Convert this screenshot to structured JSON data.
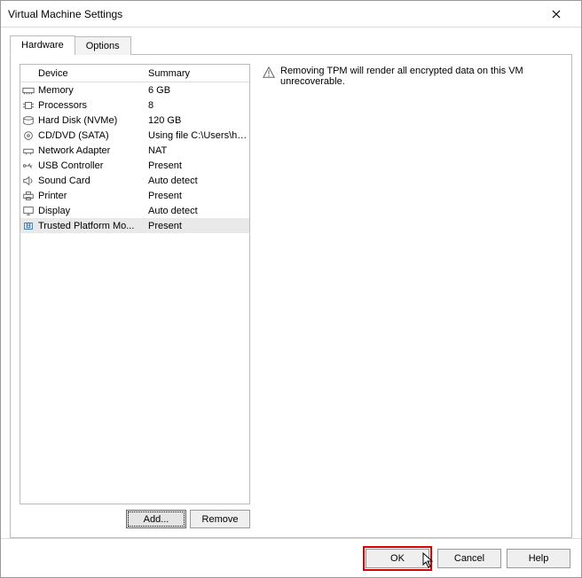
{
  "window": {
    "title": "Virtual Machine Settings"
  },
  "tabs": {
    "hardware": "Hardware",
    "options": "Options"
  },
  "headers": {
    "device": "Device",
    "summary": "Summary"
  },
  "devices": [
    {
      "icon": "memory",
      "name": "Memory",
      "summary": "6 GB"
    },
    {
      "icon": "cpu",
      "name": "Processors",
      "summary": "8"
    },
    {
      "icon": "disk",
      "name": "Hard Disk (NVMe)",
      "summary": "120 GB"
    },
    {
      "icon": "cd",
      "name": "CD/DVD (SATA)",
      "summary": "Using file C:\\Users\\hung\\Do..."
    },
    {
      "icon": "network",
      "name": "Network Adapter",
      "summary": "NAT"
    },
    {
      "icon": "usb",
      "name": "USB Controller",
      "summary": "Present"
    },
    {
      "icon": "sound",
      "name": "Sound Card",
      "summary": "Auto detect"
    },
    {
      "icon": "printer",
      "name": "Printer",
      "summary": "Present"
    },
    {
      "icon": "display",
      "name": "Display",
      "summary": "Auto detect"
    },
    {
      "icon": "tpm",
      "name": "Trusted Platform Mo...",
      "summary": "Present",
      "selected": true
    }
  ],
  "buttons": {
    "add": "Add...",
    "remove": "Remove",
    "ok": "OK",
    "cancel": "Cancel",
    "help": "Help"
  },
  "rightPanel": {
    "warning": "Removing TPM will render all encrypted data on this VM unrecoverable."
  }
}
